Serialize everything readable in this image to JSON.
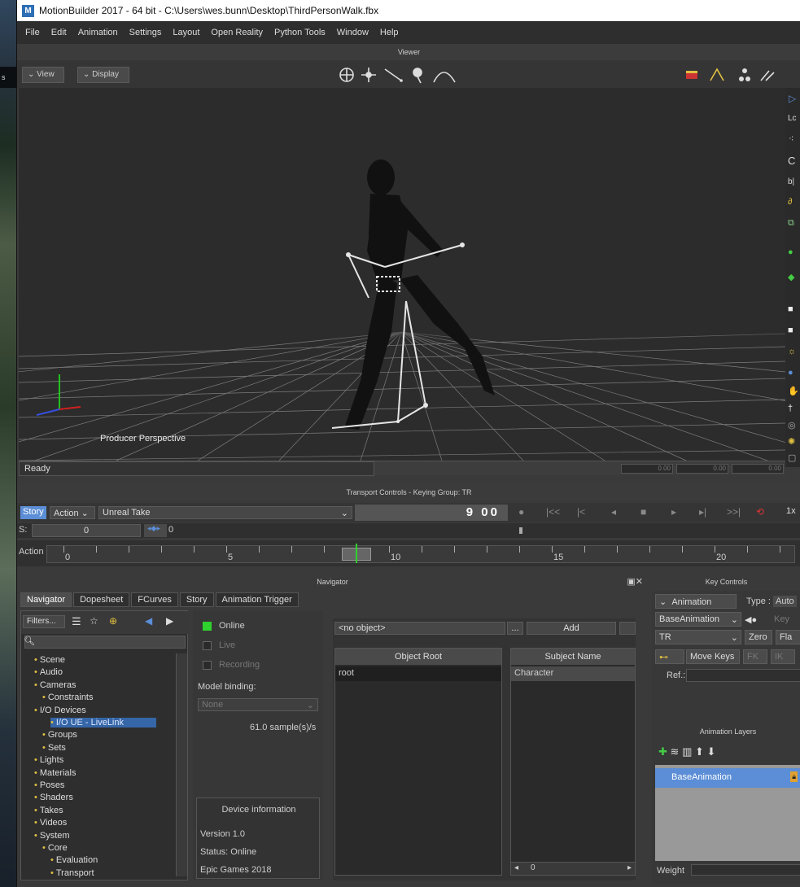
{
  "desktop": {
    "strip_label": "s"
  },
  "window": {
    "title": "MotionBuilder 2017   - 64 bit  - C:\\Users\\wes.bunn\\Desktop\\ThirdPersonWalk.fbx",
    "app_icon": "M"
  },
  "menu": [
    "File",
    "Edit",
    "Animation",
    "Settings",
    "Layout",
    "Open Reality",
    "Python Tools",
    "Window",
    "Help"
  ],
  "viewer": {
    "title": "Viewer",
    "view_btn": "View",
    "display_btn": "Display",
    "camera_label": "Producer Perspective",
    "status": "Ready",
    "time_fields": [
      "0.00",
      "0.00",
      "0.00"
    ]
  },
  "transport": {
    "title": "Transport Controls  -  Keying Group: TR",
    "story_btn": "Story",
    "action_label": "Action",
    "take": "Unreal Take",
    "frame": "9  00",
    "start_label": "S:",
    "start_value": "0",
    "loop_value": "0",
    "speed": "1x",
    "track_label": "Action",
    "ruler_labels": [
      "0",
      "5",
      "10",
      "15",
      "20"
    ]
  },
  "navigator": {
    "title": "Navigator",
    "tabs": [
      "Navigator",
      "Dopesheet",
      "FCurves",
      "Story",
      "Animation Trigger"
    ],
    "filters": "Filters...",
    "tree": [
      {
        "label": "Scene",
        "indent": 1
      },
      {
        "label": "Audio",
        "indent": 1
      },
      {
        "label": "Cameras",
        "indent": 1
      },
      {
        "label": "Constraints",
        "indent": 2
      },
      {
        "label": "I/O Devices",
        "indent": 1
      },
      {
        "label": "I/O UE - LiveLink",
        "indent": 3,
        "selected": true
      },
      {
        "label": "Groups",
        "indent": 2
      },
      {
        "label": "Sets",
        "indent": 2
      },
      {
        "label": "Lights",
        "indent": 1
      },
      {
        "label": "Materials",
        "indent": 1
      },
      {
        "label": "Poses",
        "indent": 1
      },
      {
        "label": "Shaders",
        "indent": 1
      },
      {
        "label": "Takes",
        "indent": 1
      },
      {
        "label": "Videos",
        "indent": 1
      },
      {
        "label": "System",
        "indent": 1
      },
      {
        "label": "Core",
        "indent": 2
      },
      {
        "label": "Evaluation",
        "indent": 3
      },
      {
        "label": "Transport",
        "indent": 3
      }
    ]
  },
  "device": {
    "online": "Online",
    "live": "Live",
    "recording": "Recording",
    "model_binding": "Model binding:",
    "binding_value": "None",
    "rate": "61.0 sample(s)/s",
    "info_title": "Device information",
    "version": "Version 1.0",
    "status": "Status: Online",
    "author": "Epic Games 2018"
  },
  "mapping": {
    "object_field": "<no object>",
    "more_btn": "...",
    "add_btn": "Add",
    "object_root_header": "Object Root",
    "subject_header": "Subject Name",
    "root_row": "root",
    "subject_row": "Character",
    "scroll_value": "0"
  },
  "key_controls": {
    "title": "Key Controls",
    "animation_btn": "Animation",
    "type_label": "Type :",
    "type_value": "Auto",
    "layer": "BaseAnimation",
    "key_btn": "Key",
    "group": "TR",
    "zero_btn": "Zero",
    "flat_btn": "Fla",
    "move_keys": "Move Keys",
    "fk": "FK",
    "ik": "IK",
    "ref_label": "Ref.:",
    "layers_title": "Animation Layers",
    "base_layer": "BaseAnimation",
    "weight_label": "Weight"
  },
  "colors": {
    "accent": "#5b8ed6",
    "online": "#2ed12e",
    "selection": "#3566a7"
  }
}
